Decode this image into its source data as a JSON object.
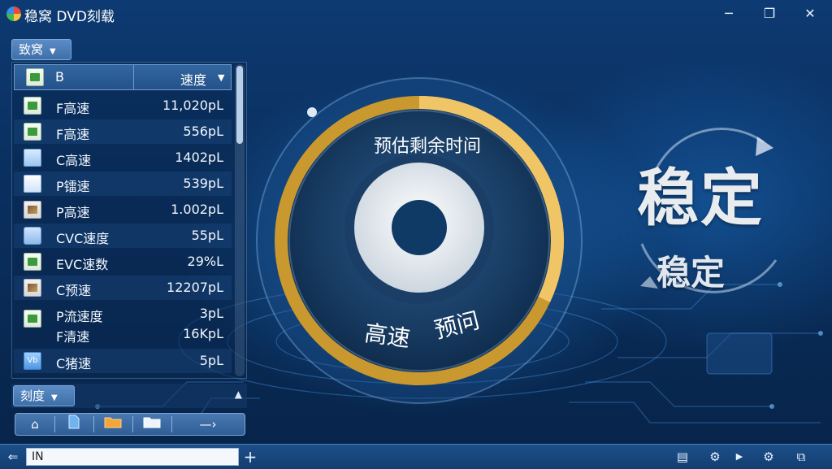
{
  "window": {
    "title": "稳窝 DVD刻载",
    "minimize_glyph": "─",
    "maximize_glyph": "❐",
    "close_glyph": "✕"
  },
  "sidebar": {
    "top_dropdown": "致窝",
    "list_header": {
      "name": "B",
      "sort_label": "速度"
    },
    "files": [
      {
        "icon": "green-file-icon",
        "name": "F高速",
        "size": "11,020pL"
      },
      {
        "icon": "green-file-icon",
        "name": "F高速",
        "size": "556pL"
      },
      {
        "icon": "blue-file-icon",
        "name": "C高速",
        "size": "1402pL"
      },
      {
        "icon": "document-icon",
        "name": "P镭速",
        "size": "539pL"
      },
      {
        "icon": "image-file-icon",
        "name": "P高速",
        "size": "1.002pL"
      },
      {
        "icon": "blue-folder-icon",
        "name": "CVC速度",
        "size": "55pL"
      },
      {
        "icon": "green-file-icon",
        "name": "EVC速数",
        "size": "29%L"
      },
      {
        "icon": "image-file-icon",
        "name": "C预速",
        "size": "12207pL"
      },
      {
        "icon": "green-file-icon",
        "name": "P流速度",
        "size": "3pL"
      },
      {
        "icon": "",
        "name": "F清速",
        "size": "16KpL"
      },
      {
        "icon": "vb-file-icon",
        "name": "C猪速",
        "size": "5pL"
      }
    ],
    "bottom_dropdown": "刻度",
    "toolbar": {
      "home_glyph": "⌂",
      "more_label": "—›"
    }
  },
  "disc": {
    "remaining_label": "预估剩余时间",
    "status_left": "高速",
    "status_right": "预问",
    "progress": 0.32,
    "ring_color": "#e3a43a"
  },
  "right_panel": {
    "big_label": "稳定",
    "small_label": "稳定"
  },
  "statusbar": {
    "input_value": "IN",
    "add_glyph": "+"
  },
  "colors": {
    "background": "#0b3466",
    "accent": "#4a9be8",
    "ring": "#e3a43a"
  }
}
